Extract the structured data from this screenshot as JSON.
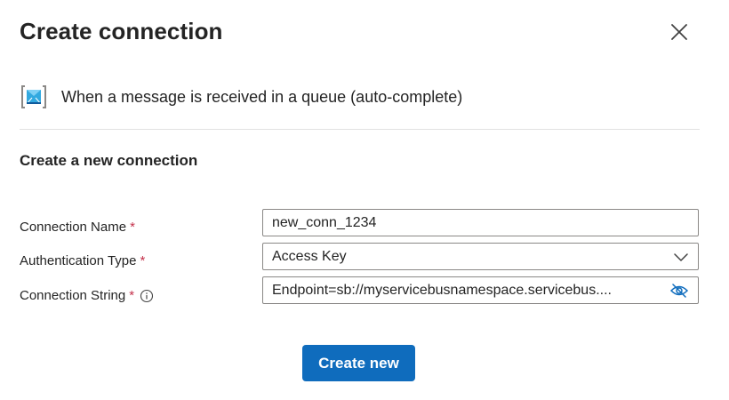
{
  "dialog": {
    "title": "Create connection"
  },
  "trigger": {
    "icon": "service-bus-queue-icon",
    "label": "When a message is received in a queue (auto-complete)"
  },
  "section": {
    "title": "Create a new connection"
  },
  "form": {
    "required_marker": "*",
    "connection_name": {
      "label": "Connection Name",
      "value": "new_conn_1234"
    },
    "auth_type": {
      "label": "Authentication Type",
      "selected": "Access Key"
    },
    "connection_string": {
      "label": "Connection String",
      "value": "Endpoint=sb://myservicebusnamespace.servicebus...."
    }
  },
  "actions": {
    "create_label": "Create new"
  },
  "colors": {
    "primary": "#0f6cbd",
    "required": "#c4314b",
    "border": "#8a8886"
  }
}
